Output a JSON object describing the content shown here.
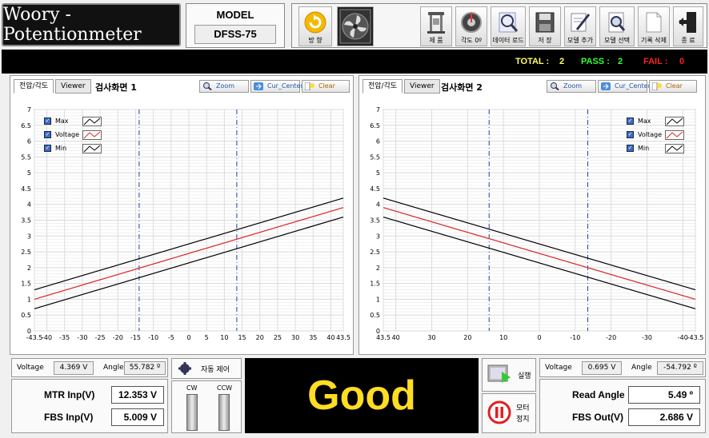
{
  "app": {
    "title": "Woory - Potentionmeter"
  },
  "model": {
    "label": "MODEL",
    "value": "DFSS-75"
  },
  "toolbar": [
    {
      "name": "direction",
      "label": "방 향",
      "icon": "refresh-arrow-icon"
    },
    {
      "name": "fan",
      "label": "",
      "icon": "fan-icon"
    },
    {
      "name": "product",
      "label": "제 품",
      "icon": "press-machine-icon"
    },
    {
      "name": "angle-zero",
      "label": "각도 0º",
      "icon": "dial-icon"
    },
    {
      "name": "data-load",
      "label": "데이터 로드",
      "icon": "magnifier-icon"
    },
    {
      "name": "save",
      "label": "저 장",
      "icon": "floppy-icon"
    },
    {
      "name": "add-model",
      "label": "모델 추가",
      "icon": "pen-paper-icon"
    },
    {
      "name": "select-model",
      "label": "모델 선택",
      "icon": "document-search-icon"
    },
    {
      "name": "delete-record",
      "label": "기록 삭제",
      "icon": "blank-document-icon"
    },
    {
      "name": "exit",
      "label": "종 료",
      "icon": "exit-door-icon"
    }
  ],
  "status": {
    "total_label": "TOTAL :",
    "total_value": "2",
    "pass_label": "PASS :",
    "pass_value": "2",
    "fail_label": "FAIL :",
    "fail_value": "0",
    "colors": {
      "total": "#ffff66",
      "pass": "#33ff33",
      "fail": "#ff2222"
    }
  },
  "panels": [
    {
      "tab_active": "전압/각도",
      "tab_other": "Viewer",
      "title": "검사화면 1",
      "buttons": {
        "zoom": "Zoom",
        "center": "Cur_Center",
        "clear": "Clear"
      },
      "legend": [
        "Max",
        "Voltage",
        "Min"
      ]
    },
    {
      "tab_active": "전압/각도",
      "tab_other": "Viewer",
      "title": "검사화면 2",
      "buttons": {
        "zoom": "Zoom",
        "center": "Cur_Center",
        "clear": "Clear"
      },
      "legend": [
        "Max",
        "Voltage",
        "Min"
      ]
    }
  ],
  "chart_data": [
    {
      "type": "line",
      "x_ticks": [
        "-43.5",
        "-40",
        "-35",
        "-30",
        "-25",
        "-20",
        "-15",
        "-10",
        "-5",
        "0",
        "5",
        "10",
        "15",
        "20",
        "25",
        "30",
        "35",
        "40",
        "43.5"
      ],
      "y_ticks": [
        "0",
        "0.5",
        "1",
        "1.5",
        "2",
        "2.5",
        "3",
        "3.5",
        "4",
        "4.5",
        "5",
        "5.5",
        "6",
        "6.5",
        "7"
      ],
      "xlim": [
        -43.5,
        43.5
      ],
      "ylim": [
        0,
        7
      ],
      "series": [
        {
          "name": "Max",
          "x": [
            -43.5,
            43.5
          ],
          "y": [
            1.3,
            4.2
          ],
          "color": "#000000"
        },
        {
          "name": "Voltage",
          "x": [
            -43.5,
            43.5
          ],
          "y": [
            1.0,
            3.9
          ],
          "color": "#dd2222"
        },
        {
          "name": "Min",
          "x": [
            -43.5,
            43.5
          ],
          "y": [
            0.7,
            3.6
          ],
          "color": "#000000"
        }
      ],
      "cursors_x": [
        -14,
        13.5
      ],
      "grid": true,
      "legend_position": "top-left"
    },
    {
      "type": "line",
      "x_ticks": [
        "43.5",
        "40",
        "30",
        "20",
        "10",
        "0",
        "-10",
        "-20",
        "-30",
        "-40",
        "-43.5"
      ],
      "y_ticks": [
        "0",
        "0.5",
        "1",
        "1.5",
        "2",
        "2.5",
        "3",
        "3.5",
        "4",
        "4.5",
        "5",
        "5.5",
        "6",
        "6.5",
        "7"
      ],
      "xlim": [
        43.5,
        -43.5
      ],
      "ylim": [
        0,
        7
      ],
      "series": [
        {
          "name": "Max",
          "x": [
            43.5,
            -43.5
          ],
          "y": [
            4.2,
            1.3
          ],
          "color": "#000000"
        },
        {
          "name": "Voltage",
          "x": [
            43.5,
            -43.5
          ],
          "y": [
            3.9,
            1.0
          ],
          "color": "#dd2222"
        },
        {
          "name": "Min",
          "x": [
            43.5,
            -43.5
          ],
          "y": [
            3.6,
            0.7
          ],
          "color": "#000000"
        }
      ],
      "cursors_x": [
        14,
        -13.5
      ],
      "grid": true,
      "legend_position": "top-right"
    }
  ],
  "readout_left": {
    "voltage_label": "Voltage",
    "voltage_value": "4.369 V",
    "angle_label": "Angle",
    "angle_value": "55.782 º"
  },
  "readout_right": {
    "voltage_label": "Voltage",
    "voltage_value": "0.695 V",
    "angle_label": "Angle",
    "angle_value": "-54.792 º"
  },
  "auto_control": {
    "label": "자동 제어",
    "cw": "CW",
    "ccw": "CCW"
  },
  "left_values": {
    "mtr_label": "MTR Inp(V)",
    "mtr_value": "12.353 V",
    "fbs_label": "FBS  Inp(V)",
    "fbs_value": "5.009 V"
  },
  "result": {
    "text": "Good"
  },
  "run": {
    "run_label": "실행",
    "stop_label_1": "모터",
    "stop_label_2": "정지"
  },
  "right_values": {
    "read_angle_label": "Read Angle",
    "read_angle_value": "5.49 º",
    "fbs_out_label": "FBS Out(V)",
    "fbs_out_value": "2.686 V"
  }
}
